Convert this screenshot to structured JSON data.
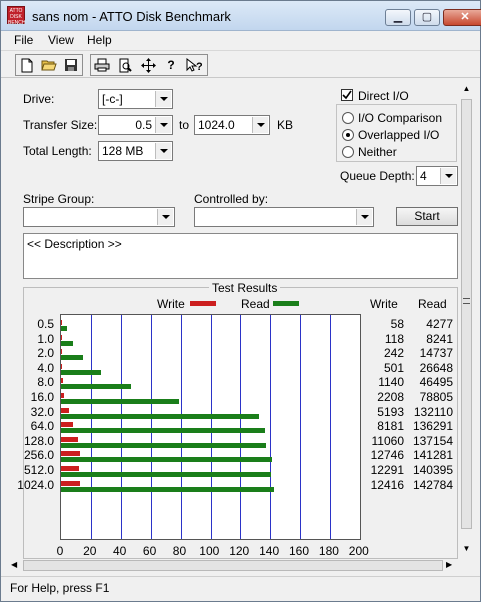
{
  "window": {
    "title": "sans nom - ATTO Disk Benchmark",
    "icon_text": "ATTO DISK BENCH"
  },
  "menu": {
    "items": [
      "File",
      "View",
      "Help"
    ]
  },
  "toolbar": {
    "icons": [
      "new-icon",
      "open-icon",
      "save-icon",
      "print-icon",
      "print-preview-icon",
      "move-icon",
      "help-icon",
      "context-help-icon"
    ]
  },
  "settings": {
    "drive_label": "Drive:",
    "drive_value": "[-c-]",
    "transfer_label": "Transfer Size:",
    "transfer_from": "0.5",
    "transfer_to_label": "to",
    "transfer_to": "1024.0",
    "transfer_unit": "KB",
    "length_label": "Total Length:",
    "length_value": "128 MB",
    "direct_io_label": "Direct I/O",
    "direct_io_checked": true,
    "radio_io_comparison": "I/O Comparison",
    "radio_overlapped": "Overlapped I/O",
    "radio_neither": "Neither",
    "queue_label": "Queue Depth:",
    "queue_value": "4",
    "stripe_label": "Stripe Group:",
    "controlled_label": "Controlled by:",
    "start_label": "Start",
    "description": "<< Description >>"
  },
  "results": {
    "group_title": "Test Results",
    "legend_write": "Write",
    "legend_read": "Read",
    "col_write": "Write",
    "col_read": "Read",
    "write_color": "#cc1f1f",
    "read_color": "#1a7e1a"
  },
  "chart_data": {
    "type": "bar",
    "orientation": "horizontal",
    "categories": [
      "0.5",
      "1.0",
      "2.0",
      "4.0",
      "8.0",
      "16.0",
      "32.0",
      "64.0",
      "128.0",
      "256.0",
      "512.0",
      "1024.0"
    ],
    "series": [
      {
        "name": "Write",
        "values": [
          58,
          118,
          242,
          501,
          1140,
          2208,
          5193,
          8181,
          11060,
          12746,
          12291,
          12416
        ],
        "color": "#cc1f1f"
      },
      {
        "name": "Read",
        "values": [
          4277,
          8241,
          14737,
          26648,
          46495,
          78805,
          132110,
          136291,
          137154,
          141281,
          140395,
          142784
        ],
        "color": "#1a7e1a"
      }
    ],
    "x_ticks": [
      "0",
      "20",
      "40",
      "60",
      "80",
      "100",
      "120",
      "140",
      "160",
      "180",
      "200"
    ],
    "xlim": [
      0,
      200
    ],
    "x_unit_scale": 1000,
    "grid": true
  },
  "status": {
    "text": "For Help, press F1"
  }
}
